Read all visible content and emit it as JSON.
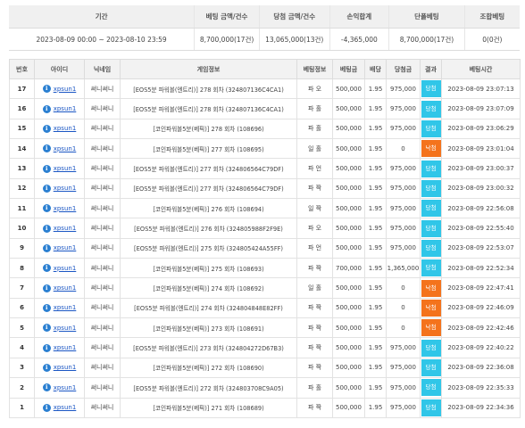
{
  "summary": {
    "headers": [
      "기간",
      "베팅 금액/건수",
      "당첨 금액/건수",
      "손익합계",
      "단폴베팅",
      "조합베팅"
    ],
    "values": [
      "2023-08-09 00:00 ~ 2023-08-10 23:59",
      "8,700,000(17건)",
      "13,065,000(13건)",
      "-4,365,000",
      "8,700,000(17건)",
      "0(0건)"
    ]
  },
  "table": {
    "headers": [
      "번호",
      "아이디",
      "닉네임",
      "게임정보",
      "베팅정보",
      "베팅금",
      "배당",
      "당첨금",
      "결과",
      "베팅시간"
    ],
    "rows": [
      {
        "no": "17",
        "id": "xpsun1",
        "nick": "써니써니",
        "game": "[EOS5분 파워볼(엔트리)] 278 회차 (324807136C4CA1)",
        "bet": "파 오",
        "amount": "500,000",
        "odds": "1.95",
        "win": "975,000",
        "result": "당첨",
        "time": "2023-08-09 23:07:13"
      },
      {
        "no": "16",
        "id": "xpsun1",
        "nick": "써니써니",
        "game": "[EOS5분 파워볼(엔트리)] 278 회차 (324807136C4CA1)",
        "bet": "파 홀",
        "amount": "500,000",
        "odds": "1.95",
        "win": "975,000",
        "result": "당첨",
        "time": "2023-08-09 23:07:09"
      },
      {
        "no": "15",
        "id": "xpsun1",
        "nick": "써니써니",
        "game": "[코인파워볼5분(베픽)] 278 회차 (108696)",
        "bet": "파 홀",
        "amount": "500,000",
        "odds": "1.95",
        "win": "975,000",
        "result": "당첨",
        "time": "2023-08-09 23:06:29"
      },
      {
        "no": "14",
        "id": "xpsun1",
        "nick": "써니써니",
        "game": "[코인파워볼5분(베픽)] 277 회차 (108695)",
        "bet": "일 홀",
        "amount": "500,000",
        "odds": "1.95",
        "win": "0",
        "result": "낙첨",
        "time": "2023-08-09 23:01:04"
      },
      {
        "no": "13",
        "id": "xpsun1",
        "nick": "써니써니",
        "game": "[EOS5분 파워볼(엔트리)] 277 회차 (324806564C79DF)",
        "bet": "파 언",
        "amount": "500,000",
        "odds": "1.95",
        "win": "975,000",
        "result": "당첨",
        "time": "2023-08-09 23:00:37"
      },
      {
        "no": "12",
        "id": "xpsun1",
        "nick": "써니써니",
        "game": "[EOS5분 파워볼(엔트리)] 277 회차 (324806564C79DF)",
        "bet": "파 짝",
        "amount": "500,000",
        "odds": "1.95",
        "win": "975,000",
        "result": "당첨",
        "time": "2023-08-09 23:00:32"
      },
      {
        "no": "11",
        "id": "xpsun1",
        "nick": "써니써니",
        "game": "[코인파워볼5분(베픽)] 276 회차 (108694)",
        "bet": "일 짝",
        "amount": "500,000",
        "odds": "1.95",
        "win": "975,000",
        "result": "당첨",
        "time": "2023-08-09 22:56:08"
      },
      {
        "no": "10",
        "id": "xpsun1",
        "nick": "써니써니",
        "game": "[EOS5분 파워볼(엔트리)] 276 회차 (324805988F2F9E)",
        "bet": "파 오",
        "amount": "500,000",
        "odds": "1.95",
        "win": "975,000",
        "result": "당첨",
        "time": "2023-08-09 22:55:40"
      },
      {
        "no": "9",
        "id": "xpsun1",
        "nick": "써니써니",
        "game": "[EOS5분 파워볼(엔트리)] 275 회차 (324805424A55FF)",
        "bet": "파 언",
        "amount": "500,000",
        "odds": "1.95",
        "win": "975,000",
        "result": "당첨",
        "time": "2023-08-09 22:53:07"
      },
      {
        "no": "8",
        "id": "xpsun1",
        "nick": "써니써니",
        "game": "[코인파워볼5분(베픽)] 275 회차 (108693)",
        "bet": "파 짝",
        "amount": "700,000",
        "odds": "1.95",
        "win": "1,365,000",
        "result": "당첨",
        "time": "2023-08-09 22:52:34"
      },
      {
        "no": "7",
        "id": "xpsun1",
        "nick": "써니써니",
        "game": "[코인파워볼5분(베픽)] 274 회차 (108692)",
        "bet": "일 홀",
        "amount": "500,000",
        "odds": "1.95",
        "win": "0",
        "result": "낙첨",
        "time": "2023-08-09 22:47:41"
      },
      {
        "no": "6",
        "id": "xpsun1",
        "nick": "써니써니",
        "game": "[EOS5분 파워볼(엔트리)] 274 회차 (324804848E82FF)",
        "bet": "파 짝",
        "amount": "500,000",
        "odds": "1.95",
        "win": "0",
        "result": "낙첨",
        "time": "2023-08-09 22:46:09"
      },
      {
        "no": "5",
        "id": "xpsun1",
        "nick": "써니써니",
        "game": "[코인파워볼5분(베픽)] 273 회차 (108691)",
        "bet": "파 짝",
        "amount": "500,000",
        "odds": "1.95",
        "win": "0",
        "result": "낙첨",
        "time": "2023-08-09 22:42:46"
      },
      {
        "no": "4",
        "id": "xpsun1",
        "nick": "써니써니",
        "game": "[EOS5분 파워볼(엔트리)] 273 회차 (324804272D67B3)",
        "bet": "파 짝",
        "amount": "500,000",
        "odds": "1.95",
        "win": "975,000",
        "result": "당첨",
        "time": "2023-08-09 22:40:22"
      },
      {
        "no": "3",
        "id": "xpsun1",
        "nick": "써니써니",
        "game": "[코인파워볼5분(베픽)] 272 회차 (108690)",
        "bet": "파 짝",
        "amount": "500,000",
        "odds": "1.95",
        "win": "975,000",
        "result": "당첨",
        "time": "2023-08-09 22:36:08"
      },
      {
        "no": "2",
        "id": "xpsun1",
        "nick": "써니써니",
        "game": "[EOS5분 파워볼(엔트리)] 272 회차 (324803708C9A05)",
        "bet": "파 홀",
        "amount": "500,000",
        "odds": "1.95",
        "win": "975,000",
        "result": "당첨",
        "time": "2023-08-09 22:35:33"
      },
      {
        "no": "1",
        "id": "xpsun1",
        "nick": "써니써니",
        "game": "[코인파워볼5분(베픽)] 271 회차 (108689)",
        "bet": "파 짝",
        "amount": "500,000",
        "odds": "1.95",
        "win": "975,000",
        "result": "당첨",
        "time": "2023-08-09 22:34:36"
      }
    ]
  },
  "icons": {
    "info": "info-icon",
    "info_glyph": "i"
  },
  "colors": {
    "win": "#30c6e8",
    "lose": "#f4731c",
    "link": "#1a56c4",
    "info": "#2a7fd1"
  }
}
